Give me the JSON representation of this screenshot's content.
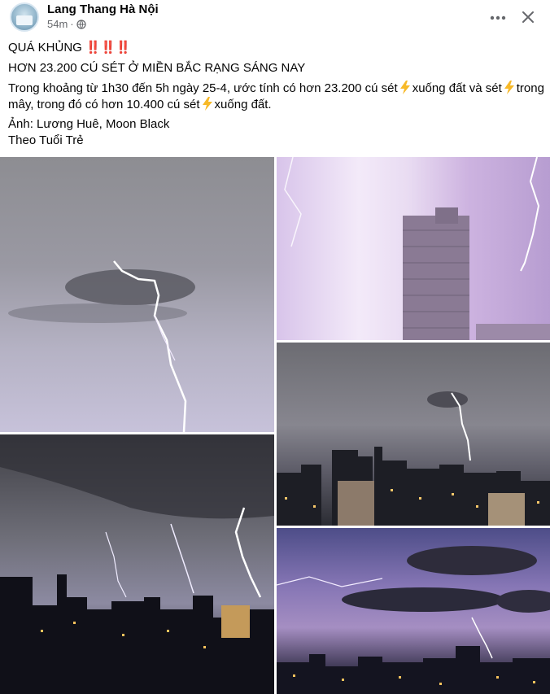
{
  "post": {
    "page_name": "Lang Thang Hà Nội",
    "time": "54m",
    "dot": "·",
    "icons": {
      "avatar": "page-avatar",
      "privacy": "globe-icon",
      "more": "more-options-icon",
      "close": "close-icon",
      "bolt": "lightning-emoji"
    },
    "title_line": "QUÁ KHỦNG",
    "exclaim": "‼️‼️‼️",
    "headline": "HƠN 23.200 CÚ SÉT Ở MIỀN BẮC RẠNG SÁNG NAY",
    "body_line1_a": "Trong khoảng từ 1h30 đến 5h ngày 25-4, ước tính có hơn 23.200 cú sét",
    "body_line1_b": "xuống đất và sét",
    "body_line1_c": "trong",
    "body_line2_a": "mây, trong đó có hơn 10.400 cú sét",
    "body_line2_b": "xuống đất.",
    "credit": "Ảnh: Lương Huê, Moon Black",
    "source": "Theo Tuổi Trẻ"
  },
  "colors": {
    "text": "#050505",
    "secondary": "#65676b",
    "exclaim": "#e41e3f",
    "bolt": "#f7b928"
  }
}
